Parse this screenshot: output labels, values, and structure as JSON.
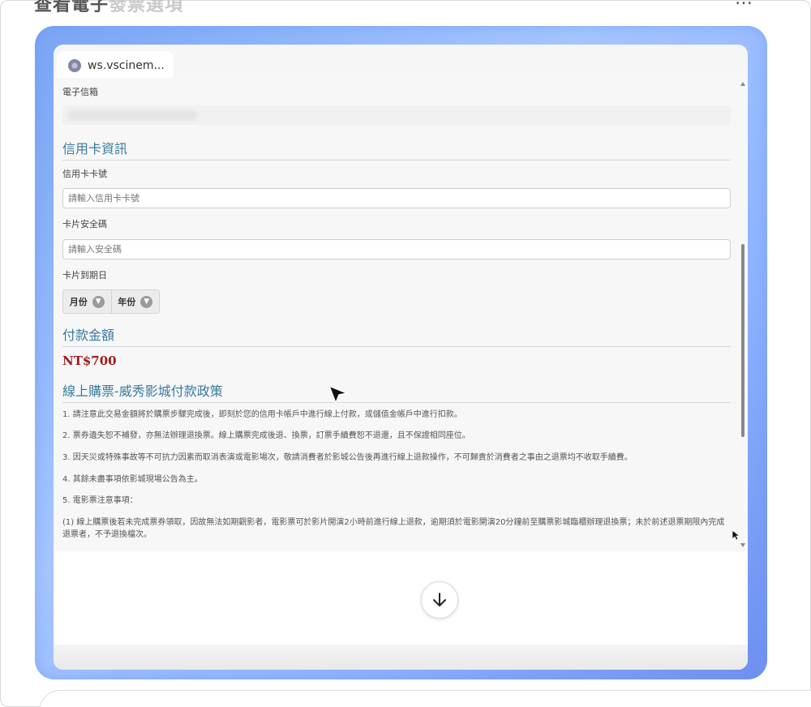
{
  "page": {
    "title_main": "查看電子",
    "title_faded": "發票選項",
    "more_label": "…"
  },
  "browser": {
    "tab_label": "ws.vscinem..."
  },
  "form": {
    "email_label": "電子信箱",
    "credit_section_title": "信用卡資訊",
    "card_number_label": "信用卡卡號",
    "card_number_placeholder": "請輸入信用卡卡號",
    "cvv_label": "卡片安全碼",
    "cvv_placeholder": "請輸入安全碼",
    "expiry_label": "卡片到期日",
    "month_label": "月份",
    "year_label": "年份",
    "amount_section_title": "付款金額",
    "amount_value": "NT$700",
    "policy_section_title": "線上購票-威秀影城付款政策",
    "policy_items": [
      "1. 請注意此交易金額將於購票步驟完成後，即刻於您的信用卡帳戶中進行線上付款，或儲值金帳戶中進行扣款。",
      "2. 票券遺失恕不補發，亦無法辦理退換票。線上購票完成後退、換票，訂票手續費恕不退還，且不保證相同座位。",
      "3. 因天災或特殊事故等不可抗力因素而取消表演或電影場次，敬請消費者於影城公告後再進行線上退款操作，不可歸責於消費者之事由之退票均不收取手續費。",
      "4. 其餘未盡事項依影城現場公告為主。",
      "5. 電影票注意事項：",
      "(1) 線上購票後若未完成票券領取，因故無法如期觀影者，電影票可於影片開演2小時前進行線上退款，逾期須於電影開演20分鐘前至購票影城臨櫃辦理退換票；未於前述退票期限內完成退票者，不予退換檔次。"
    ]
  },
  "icons": {
    "globe": "globe-icon",
    "chevron": "chevron-down-icon",
    "arrow_down": "arrow-down-icon",
    "cursor": "cursor-icon"
  },
  "colors": {
    "section_title": "#3a7ba0",
    "amount": "#a11a1a",
    "glow": "#8fb3ff"
  }
}
